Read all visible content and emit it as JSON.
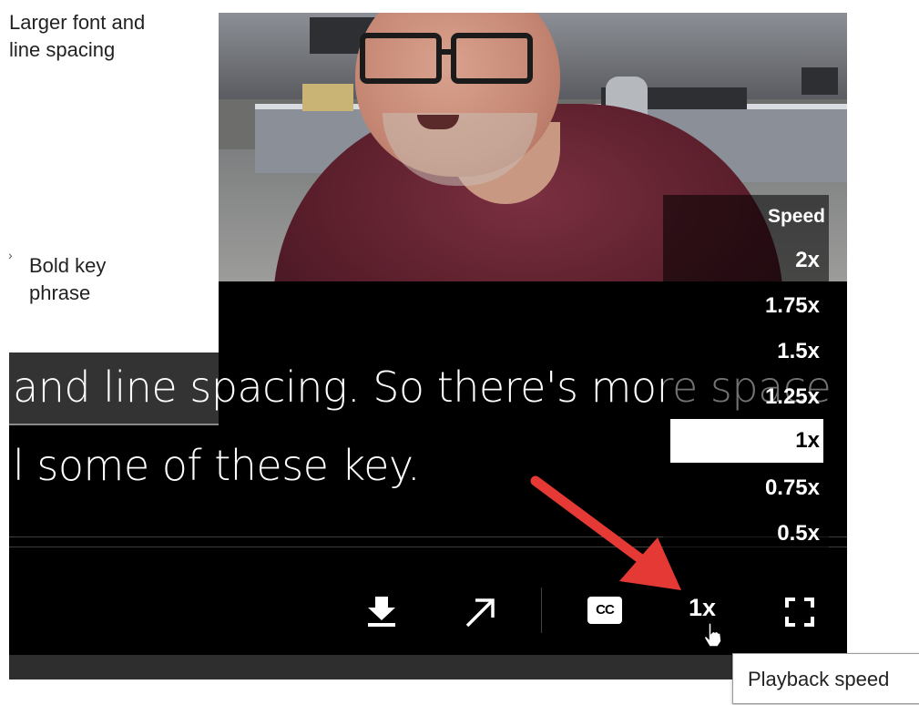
{
  "slide": {
    "note1_line1": "Larger font and",
    "note1_line2": "line spacing",
    "note2_line1": "Bold key",
    "note2_line2": "phrase"
  },
  "captions": {
    "line1": "and line spacing. So there's more space",
    "line2": "l some of these key."
  },
  "speed_menu": {
    "title": "Speed",
    "options": [
      {
        "label": "2x"
      },
      {
        "label": "1.75x"
      },
      {
        "label": "1.5x"
      },
      {
        "label": "1.25x"
      },
      {
        "label": "1x",
        "selected": true
      },
      {
        "label": "0.75x"
      },
      {
        "label": "0.5x"
      }
    ]
  },
  "controls": {
    "cc_label": "CC",
    "speed_label": "1x"
  },
  "tooltip": {
    "text": "Playback speed"
  },
  "colors": {
    "annotation_arrow": "#e53935",
    "player_bg": "#000000",
    "selected_bg": "#ffffff"
  }
}
